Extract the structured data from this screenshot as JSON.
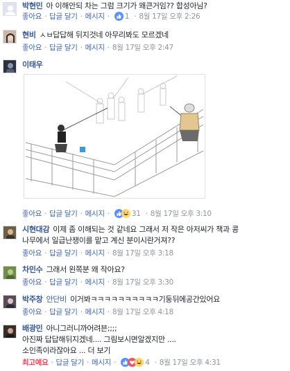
{
  "comments": [
    {
      "author": "박현민",
      "text": "아 이해안되 차는 그럼 크기가 왜큰거임?? 합성아님?",
      "actions": {
        "like": "좋아요",
        "reply": "답글 달기",
        "message": "메시지"
      },
      "reactions": {
        "count": "1",
        "types": [
          "like"
        ]
      },
      "time": "8월 17일 오후 2:26"
    },
    {
      "author": "현비",
      "text": "ㅅㅂ답답해 뒤지것네 아무리봐도 모르겠네",
      "actions": {
        "like": "좋아요",
        "reply": "답글 달기",
        "message": "메시지"
      },
      "time": "8월 17일 오후 2:47"
    },
    {
      "author": "이태우",
      "image_alt": "illustration of people fishing on a bridge railing",
      "actions": {
        "like": "좋아요",
        "reply": "답글 달기",
        "message": "메시지"
      },
      "reactions": {
        "count": "31",
        "types": [
          "like",
          "haha"
        ]
      },
      "time": "8월 17일 오후 3:10"
    },
    {
      "author": "시현대감",
      "text": "이제 좀 이해되는 것 같네요 그래서 저 작은 아저씨가 책과 콩",
      "text2": "나무에서 일급난쟁이를 맡고 계신 분이시란거져??",
      "actions": {
        "like": "좋아요",
        "reply": "답글 달기",
        "message": "메시지"
      },
      "time": "8월 17일 오후 3:18"
    },
    {
      "author": "차민수",
      "text": "그래서 왼쪽분 왜 작아요?",
      "actions": {
        "like": "좋아요",
        "reply": "답글 달기",
        "message": "메시지"
      },
      "time": "8월 17일 오후 3:30"
    },
    {
      "author": "박주창",
      "mention": "안단비",
      "text": "이거봐ㅋㅋㅋㅋㅋㅋㅋㅋㅋㅋ기둥뒤에공간있어요",
      "actions": {
        "like": "좋아요",
        "reply": "답글 달기",
        "message": "메시지"
      },
      "time": "8월 17일 오후 4:18"
    },
    {
      "author": "배광민",
      "text": "아니그러니까어려븐;;;;",
      "text2": "아진짜 답답해뒤지겠네.... 그림보시면알겠지만 ....",
      "text3": "소인족이라잖아요 ... 더 보기",
      "actions": {
        "like": "최고예요",
        "reply": "답글 달기",
        "message": "메시지"
      },
      "reactions": {
        "count": "4",
        "types": [
          "like",
          "love",
          "haha"
        ]
      },
      "time": "8월 17일 오후 4:31"
    }
  ],
  "colors": {
    "author": "#365899",
    "action": "#4267b2",
    "meta": "#90949c",
    "text": "#1d2129",
    "love_active": "#f33e58",
    "like_icon": "#5890ff",
    "love_icon": "#f25268",
    "haha_icon": "#fcd669"
  }
}
